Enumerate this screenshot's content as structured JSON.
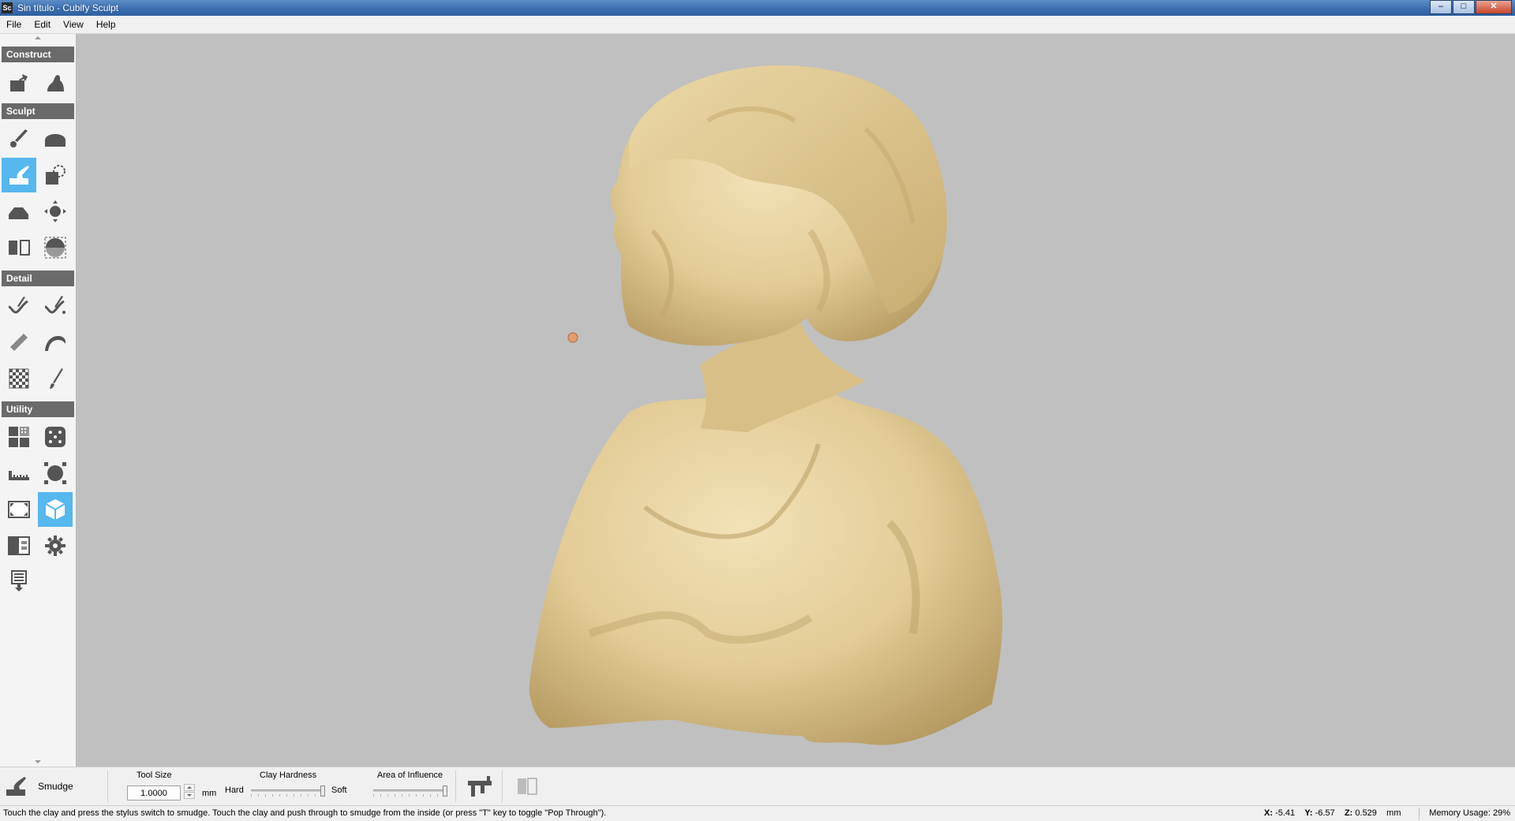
{
  "window": {
    "app_icon_text": "Sc",
    "title": "Sin título - Cubify Sculpt",
    "buttons": {
      "minimize": "–",
      "maximize": "□",
      "close": "✕"
    }
  },
  "menu": [
    "File",
    "Edit",
    "View",
    "Help"
  ],
  "toolbar": {
    "sections": {
      "construct": "Construct",
      "sculpt": "Sculpt",
      "detail": "Detail",
      "utility": "Utility"
    },
    "active_tools": [
      "smudge",
      "view-cube"
    ]
  },
  "viewport": {
    "background": "#c0c0c0",
    "model_color": "#e6d2a2",
    "cursor_color": "#e49c71"
  },
  "options": {
    "tool_name": "Smudge",
    "tool_size_label": "Tool Size",
    "tool_size_value": "1.0000",
    "tool_size_unit": "mm",
    "clay_hardness_label": "Clay Hardness",
    "hard_label": "Hard",
    "soft_label": "Soft",
    "clay_hardness_level": 1.0,
    "area_label": "Area of Influence",
    "area_level": 1.0
  },
  "status": {
    "hint": "Touch the clay and press the stylus switch to smudge. Touch the clay and push through to smudge from the inside (or press \"T\" key to toggle \"Pop Through\").",
    "x_label": "X:",
    "x_value": "-5.41",
    "y_label": "Y:",
    "y_value": "-6.57",
    "z_label": "Z:",
    "z_value": "0.529",
    "unit": "mm",
    "memory": "Memory Usage: 29%"
  }
}
